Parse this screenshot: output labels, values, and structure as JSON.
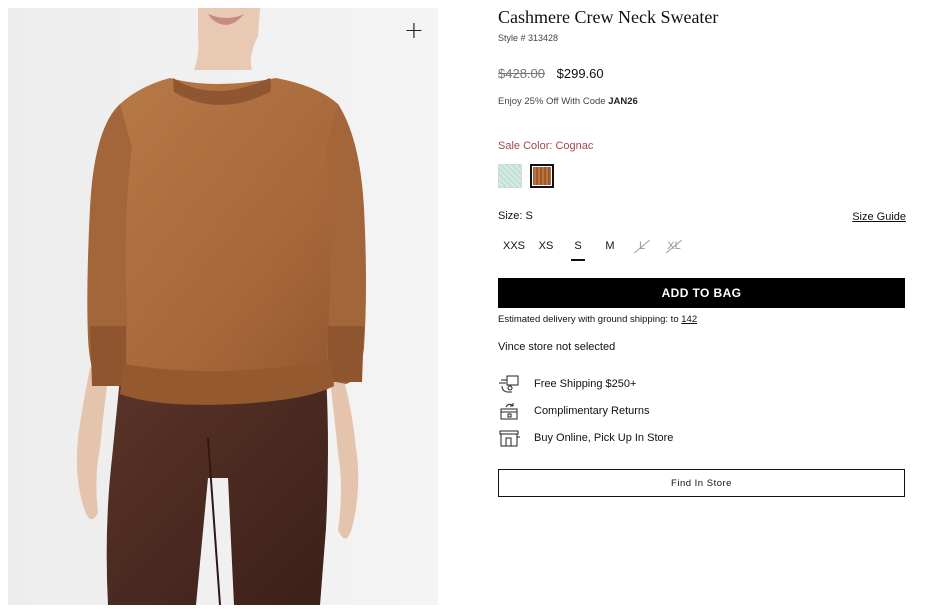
{
  "product": {
    "title": "Cashmere Crew Neck Sweater",
    "style_number": "Style # 313428",
    "price_original": "$428.00",
    "price_sale": "$299.60",
    "promo_text": "Enjoy 25% Off With Code ",
    "promo_code": "JAN26",
    "image_zoom_label": "+"
  },
  "color": {
    "label": "Sale Color: Cognac",
    "swatches": [
      {
        "name": "mint",
        "selected": false,
        "hex": "#cfe6dc"
      },
      {
        "name": "cognac",
        "selected": true,
        "hex": "#a8683a"
      }
    ]
  },
  "size": {
    "label": "Size: S",
    "guide_label": "Size Guide",
    "options": [
      {
        "label": "XXS",
        "available": true
      },
      {
        "label": "XS",
        "available": true
      },
      {
        "label": "S",
        "available": true,
        "selected": true
      },
      {
        "label": "M",
        "available": true
      },
      {
        "label": "L",
        "available": false
      },
      {
        "label": "XL",
        "available": false
      }
    ]
  },
  "actions": {
    "add_to_bag": "ADD TO BAG",
    "find_in_store": "Find In Store"
  },
  "delivery": {
    "text": "Estimated delivery with ground shipping: to ",
    "zip": "142"
  },
  "store": {
    "status": "Vince store not selected"
  },
  "perks": [
    {
      "icon": "shipping-icon",
      "label": "Free Shipping $250+"
    },
    {
      "icon": "returns-icon",
      "label": "Complimentary Returns"
    },
    {
      "icon": "store-pickup-icon",
      "label": "Buy Online, Pick Up In Store"
    }
  ],
  "colors": {
    "sale_text": "#a14a4a",
    "button_bg": "#000000",
    "sweater": "#a8683a",
    "pants": "#4a2a20"
  }
}
